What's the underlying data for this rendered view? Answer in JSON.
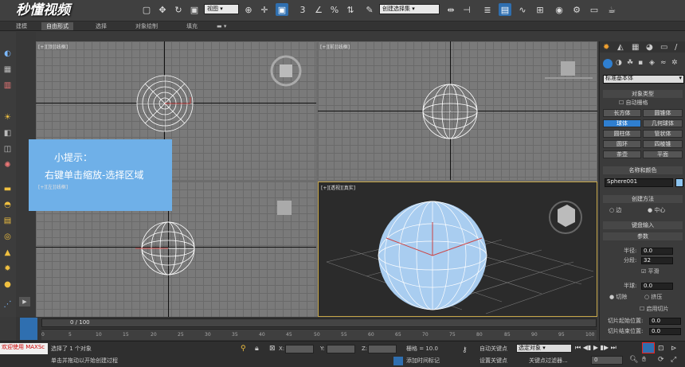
{
  "watermark": {
    "text": "秒懂视频"
  },
  "toolbar": {
    "view_select": "视图",
    "selection_set_select": "创建选择集",
    "icons": [
      "undo-icon",
      "redo-icon",
      "link-icon",
      "unlink-icon",
      "bind-icon",
      "select-icon",
      "select-name-icon",
      "rect-select-icon",
      "window-crossing-icon",
      "move-icon",
      "rotate-icon",
      "scale-icon",
      "pivot-icon",
      "snap-icon",
      "angle-snap-icon",
      "percent-snap-icon",
      "spinner-snap-icon",
      "edit-named-icon",
      "mirror-icon",
      "align-icon",
      "layers-icon",
      "ribbon-icon",
      "curve-editor-icon",
      "schematic-icon",
      "material-editor-icon",
      "render-setup-icon",
      "render-frame-icon",
      "render-icon"
    ]
  },
  "ribbon": {
    "tabs": [
      "建模",
      "自由形式",
      "选择",
      "对象绘制",
      "填充"
    ],
    "active_tab": 1
  },
  "viewports": {
    "top": {
      "label": "[+][顶][线框]"
    },
    "front": {
      "label": "[+][前][线框]"
    },
    "left": {
      "label": "[+][左][线框]"
    },
    "perspective": {
      "label": "[+][透视][真实]"
    }
  },
  "tip": {
    "title": "小提示：",
    "body": "右键单击缩放-选择区域"
  },
  "command_panel": {
    "dropdown": "标准基本体",
    "object_type_header": "对象类型",
    "autogrid": "自动栅格",
    "buttons": [
      "长方体",
      "圆锥体",
      "球体",
      "几何球体",
      "圆柱体",
      "管状体",
      "圆环",
      "四棱锥",
      "茶壶",
      "平面"
    ],
    "active_button": 2,
    "name_color_header": "名称和颜色",
    "object_name": "Sphere001",
    "creation_method_header": "创建方法",
    "creation_options": [
      "边",
      "中心"
    ],
    "creation_selected": 1,
    "keyboard_entry": "键盘输入",
    "params_header": "参数",
    "radius_label": "半径:",
    "radius_value": "0.0",
    "segments_label": "分段:",
    "segments_value": "32",
    "smooth_label": "平滑",
    "hemisphere_label": "半球:",
    "hemisphere_value": "0.0",
    "chop_label": "切除",
    "squash_label": "挤压",
    "enable_slice_label": "启用切片",
    "slice_from_label": "切片起始位置:",
    "slice_from_value": "0.0",
    "slice_to_label": "切片结束位置:",
    "slice_to_value": "0.0"
  },
  "timeline": {
    "frame_counter": "0 / 100",
    "ticks": [
      "0",
      "5",
      "10",
      "15",
      "20",
      "25",
      "30",
      "35",
      "40",
      "45",
      "50",
      "55",
      "60",
      "65",
      "70",
      "75",
      "80",
      "85",
      "90",
      "95",
      "100"
    ]
  },
  "status": {
    "welcome": "欢迎使用 MAXSc",
    "selected_msg": "选择了 1 个对象",
    "prompt_msg": "单击并拖动以开始创建过程",
    "x_label": "X:",
    "y_label": "Y:",
    "z_label": "Z:",
    "grid_label": "栅格 = 10.0",
    "add_time_tag": "添加时间标记",
    "auto_key": "自动关键点",
    "set_key": "设置关键点",
    "key_filter": "关键点过滤器...",
    "selected_object": "选定对象",
    "frame_value": "0"
  }
}
